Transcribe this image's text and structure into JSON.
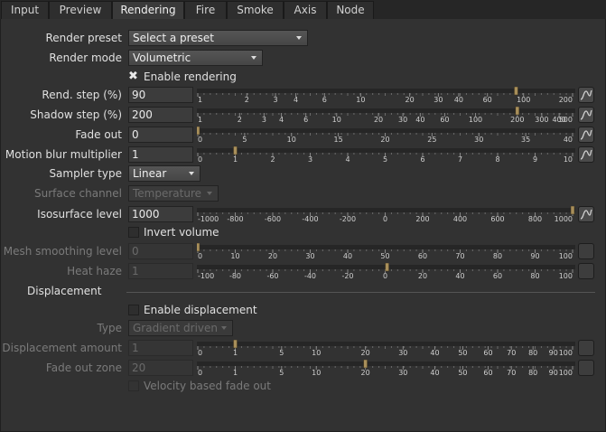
{
  "tabs": [
    {
      "label": "Input",
      "active": false
    },
    {
      "label": "Preview",
      "active": false
    },
    {
      "label": "Rendering",
      "active": true
    },
    {
      "label": "Fire",
      "active": false
    },
    {
      "label": "Smoke",
      "active": false
    },
    {
      "label": "Axis",
      "active": false
    },
    {
      "label": "Node",
      "active": false
    }
  ],
  "render_preset": {
    "label": "Render preset",
    "value": "Select a preset"
  },
  "render_mode": {
    "label": "Render mode",
    "value": "Volumetric"
  },
  "enable_rendering": {
    "label": "Enable rendering",
    "checked": true
  },
  "rend_step": {
    "label": "Rend. step (%)",
    "value": "90",
    "ticks": [
      "1",
      "2",
      "3",
      "4",
      "6",
      "10",
      "20",
      "30",
      "40",
      "60",
      "100",
      "200"
    ],
    "scale": "log",
    "min": 1,
    "max": 200,
    "current": 90
  },
  "shadow_step": {
    "label": "Shadow step (%)",
    "value": "200",
    "ticks": [
      "1",
      "2",
      "3",
      "4",
      "6",
      "10",
      "20",
      "30",
      "40",
      "60",
      "100",
      "200",
      "300",
      "400",
      "500"
    ],
    "scale": "log",
    "min": 1,
    "max": 500,
    "current": 200
  },
  "fade_out": {
    "label": "Fade out",
    "value": "0",
    "ticks": [
      "0",
      "5",
      "10",
      "15",
      "20",
      "25",
      "30",
      "35",
      "40"
    ],
    "scale": "linear",
    "min": 0,
    "max": 40,
    "current": 0
  },
  "motion_blur": {
    "label": "Motion blur multiplier",
    "value": "1",
    "ticks": [
      "0",
      "1",
      "2",
      "3",
      "4",
      "5",
      "6",
      "7",
      "8",
      "9",
      "10"
    ],
    "scale": "linear",
    "min": 0,
    "max": 10,
    "current": 1
  },
  "sampler_type": {
    "label": "Sampler type",
    "value": "Linear"
  },
  "surface_channel": {
    "label": "Surface channel",
    "value": "Temperature"
  },
  "isosurface_level": {
    "label": "Isosurface level",
    "value": "1000",
    "ticks": [
      "-1000",
      "-800",
      "-600",
      "-400",
      "-200",
      "0",
      "200",
      "400",
      "600",
      "800",
      "1000"
    ],
    "scale": "linear",
    "min": -1000,
    "max": 1000,
    "current": 1000
  },
  "invert_volume": {
    "label": "Invert volume",
    "checked": false
  },
  "mesh_smoothing": {
    "label": "Mesh smoothing level",
    "value": "0",
    "ticks": [
      "0",
      "10",
      "20",
      "30",
      "40",
      "50",
      "60",
      "70",
      "80",
      "90",
      "100"
    ],
    "scale": "linear",
    "min": 0,
    "max": 100,
    "current": 0
  },
  "heat_haze": {
    "label": "Heat haze",
    "value": "1",
    "ticks": [
      "-100",
      "-80",
      "-60",
      "-40",
      "-20",
      "0",
      "20",
      "40",
      "60",
      "80",
      "100"
    ],
    "scale": "linear",
    "min": -100,
    "max": 100,
    "current": 1
  },
  "displacement": {
    "section_label": "Displacement"
  },
  "enable_displacement": {
    "label": "Enable displacement",
    "checked": false
  },
  "disp_type": {
    "label": "Type",
    "value": "Gradient driven"
  },
  "disp_amount": {
    "label": "Displacement amount",
    "value": "1",
    "ticks": [
      "0",
      "1",
      "5",
      "10",
      "20",
      "30",
      "40",
      "50",
      "60",
      "70",
      "80",
      "90",
      "100"
    ],
    "scale": "sqrt",
    "min": 0,
    "max": 100,
    "current": 1
  },
  "fade_out_zone": {
    "label": "Fade out zone",
    "value": "20",
    "ticks": [
      "0",
      "1",
      "5",
      "10",
      "20",
      "30",
      "40",
      "50",
      "60",
      "70",
      "80",
      "90",
      "100"
    ],
    "scale": "sqrt",
    "min": 0,
    "max": 100,
    "current": 20
  },
  "velocity_fade": {
    "label": "Velocity based fade out",
    "checked": false
  }
}
